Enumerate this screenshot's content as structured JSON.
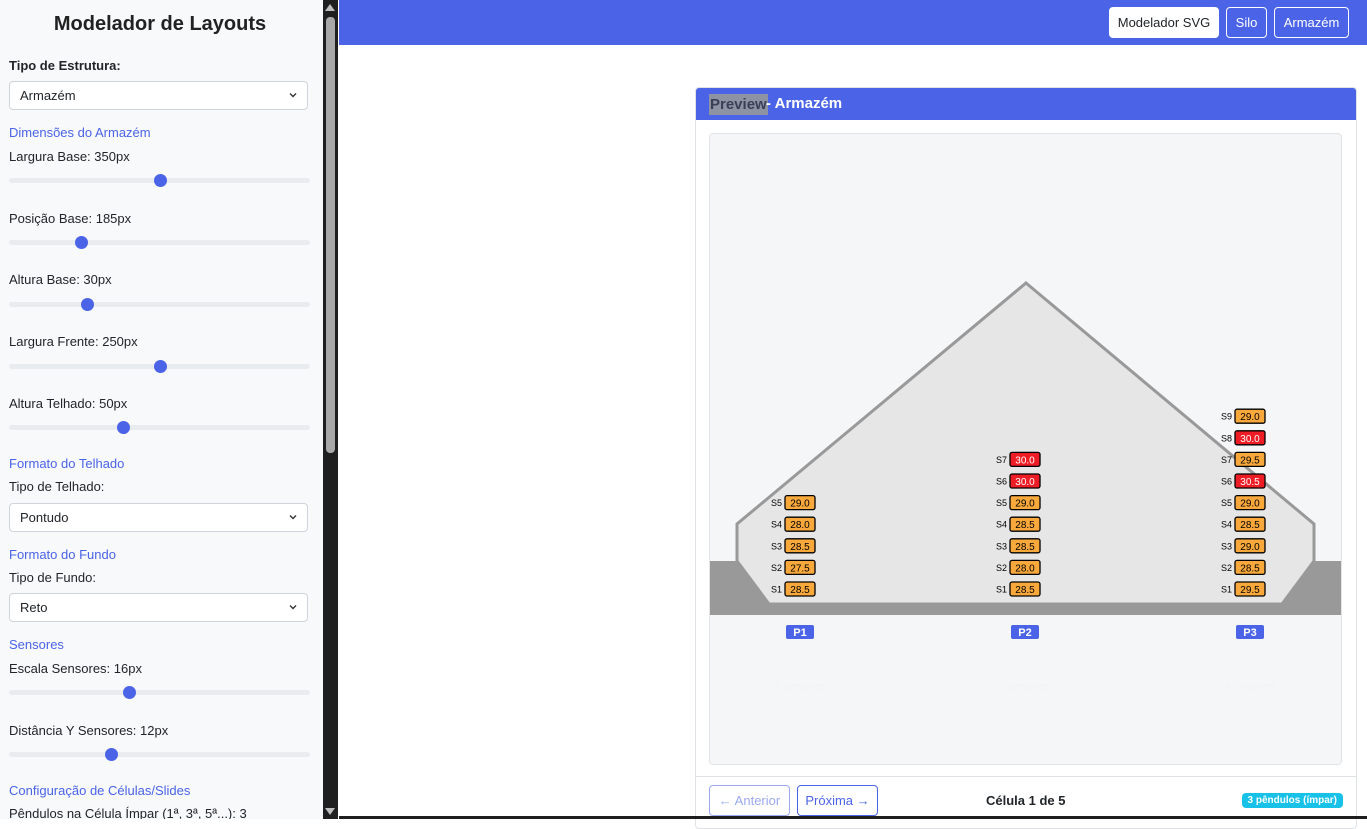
{
  "sidebar": {
    "title": "Modelador de Layouts",
    "structure_label": "Tipo de Estrutura:",
    "structure_value": "Armazém",
    "dimensions_title": "Dimensões do Armazém",
    "sliders": [
      {
        "label": "Largura Base: 350px",
        "fill": 0.5
      },
      {
        "label": "Posição Base: 185px",
        "fill": 0.24
      },
      {
        "label": "Altura Base: 30px",
        "fill": 0.26
      },
      {
        "label": "Largura Frente: 250px",
        "fill": 0.5
      },
      {
        "label": "Altura Telhado: 50px",
        "fill": 0.38
      }
    ],
    "roof_section": "Formato do Telhado",
    "roof_label": "Tipo de Telhado:",
    "roof_value": "Pontudo",
    "bottom_section": "Formato do Fundo",
    "bottom_label": "Tipo de Fundo:",
    "bottom_value": "Reto",
    "sensors_section": "Sensores",
    "sensor_sliders": [
      {
        "label": "Escala Sensores: 16px",
        "fill": 0.4
      },
      {
        "label": "Distância Y Sensores: 12px",
        "fill": 0.34
      }
    ],
    "cells_section": "Configuração de Células/Slides",
    "cells_label": "Pêndulos na Célula Ímpar (1ª, 3ª, 5ª...): 3"
  },
  "topbar": {
    "buttons": [
      {
        "label": "Modelador SVG",
        "active": true
      },
      {
        "label": "Silo",
        "active": false
      },
      {
        "label": "Armazém",
        "active": false
      }
    ]
  },
  "preview": {
    "title_highlight": "Preview",
    "title_rest": "- Armazém",
    "colors": {
      "accent": "#4a63e7",
      "hot": "#ee1c25",
      "warm": "#f9a83c",
      "roof": "#e6e6e6",
      "ground": "#999999"
    },
    "pendulums": [
      {
        "id": "P1",
        "caption": "5 Sensores",
        "sensors": [
          {
            "name": "S1",
            "value": "28.5",
            "status": "warm"
          },
          {
            "name": "S2",
            "value": "27.5",
            "status": "warm"
          },
          {
            "name": "S3",
            "value": "28.5",
            "status": "warm"
          },
          {
            "name": "S4",
            "value": "28.0",
            "status": "warm"
          },
          {
            "name": "S5",
            "value": "29.0",
            "status": "warm"
          }
        ]
      },
      {
        "id": "P2",
        "caption": "7 Sensores",
        "sensors": [
          {
            "name": "S1",
            "value": "28.5",
            "status": "warm"
          },
          {
            "name": "S2",
            "value": "28.0",
            "status": "warm"
          },
          {
            "name": "S3",
            "value": "28.5",
            "status": "warm"
          },
          {
            "name": "S4",
            "value": "28.5",
            "status": "warm"
          },
          {
            "name": "S5",
            "value": "29.0",
            "status": "warm"
          },
          {
            "name": "S6",
            "value": "30.0",
            "status": "hot"
          },
          {
            "name": "S7",
            "value": "30.0",
            "status": "hot"
          }
        ]
      },
      {
        "id": "P3",
        "caption": "9 Sensores",
        "sensors": [
          {
            "name": "S1",
            "value": "29.5",
            "status": "warm"
          },
          {
            "name": "S2",
            "value": "28.5",
            "status": "warm"
          },
          {
            "name": "S3",
            "value": "29.0",
            "status": "warm"
          },
          {
            "name": "S4",
            "value": "28.5",
            "status": "warm"
          },
          {
            "name": "S5",
            "value": "29.0",
            "status": "warm"
          },
          {
            "name": "S6",
            "value": "30.5",
            "status": "hot"
          },
          {
            "name": "S7",
            "value": "29.5",
            "status": "warm"
          },
          {
            "name": "S8",
            "value": "30.0",
            "status": "hot"
          },
          {
            "name": "S9",
            "value": "29.0",
            "status": "warm"
          }
        ]
      }
    ]
  },
  "footer": {
    "prev_label": "← Anterior",
    "next_label": "Próxima →",
    "cell_info": "Célula 1 de 5",
    "badge": "3 pêndulos (ímpar)"
  }
}
